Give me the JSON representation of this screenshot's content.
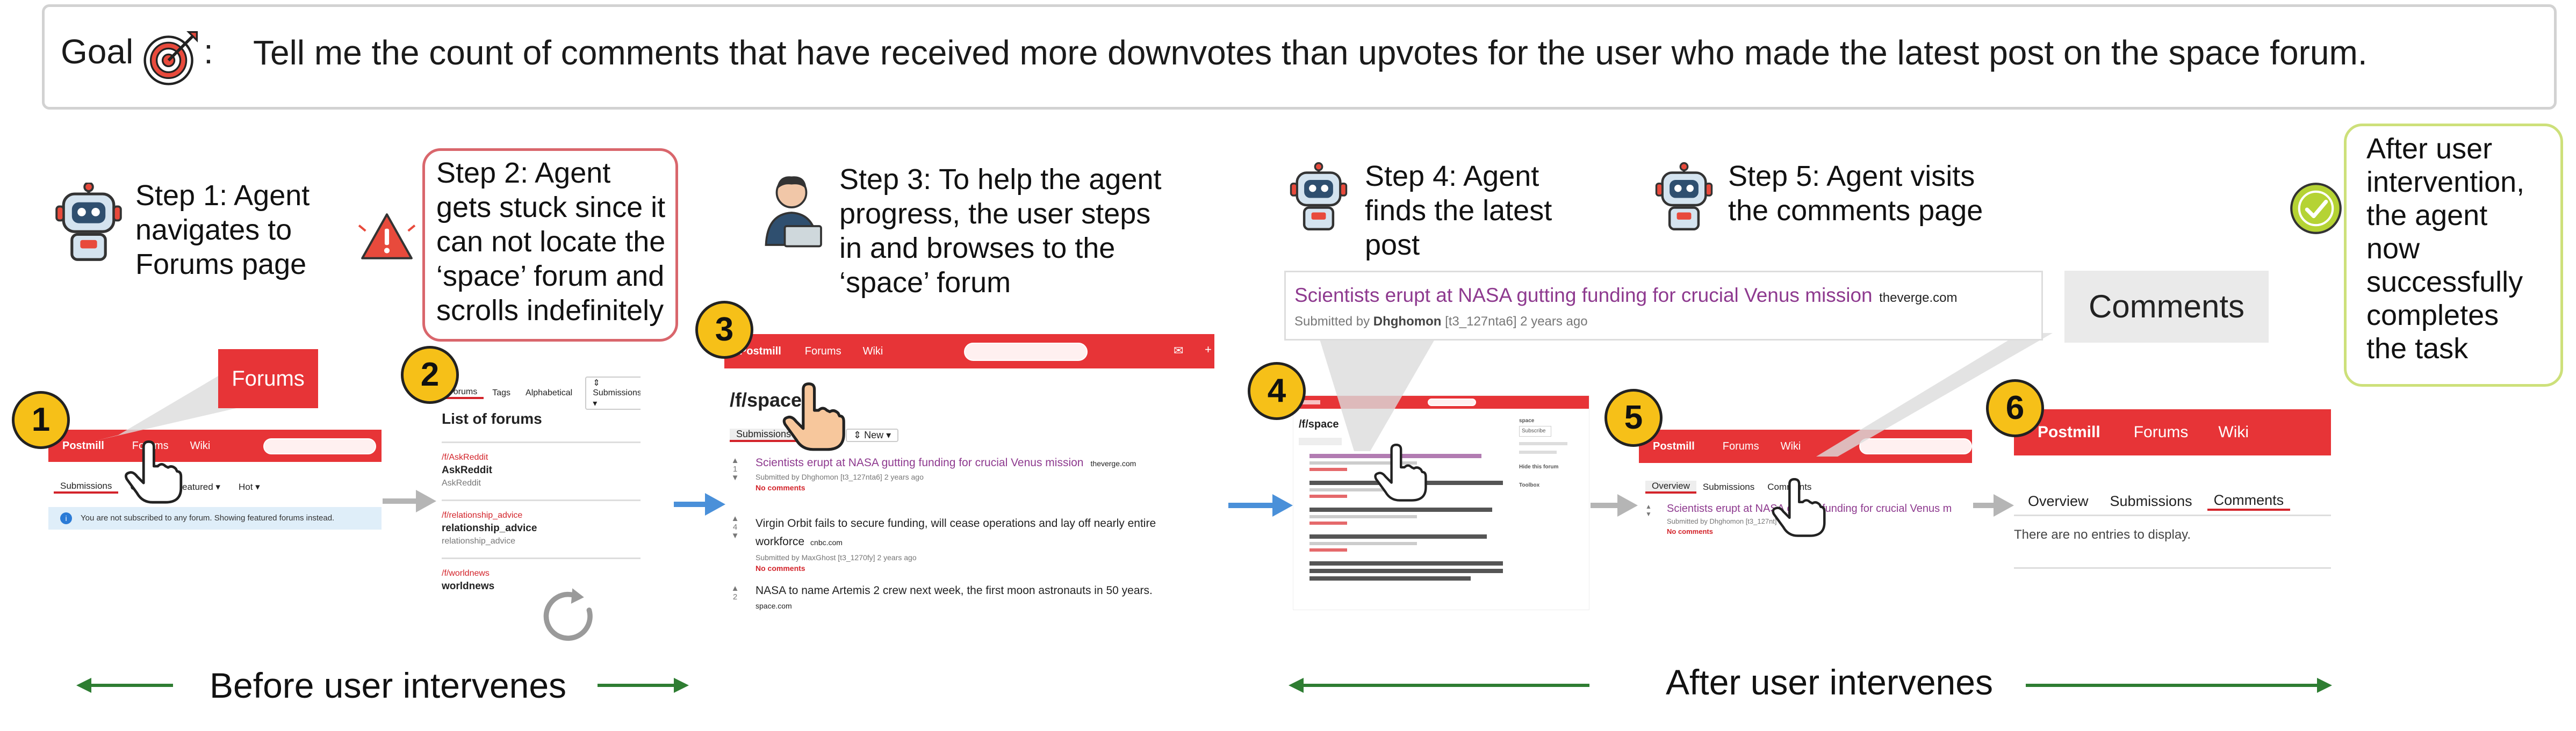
{
  "goal": {
    "label": "Goal",
    "colon": ":",
    "text": "Tell me the count of comments that have received more downvotes than upvotes for the user who made the latest post on the space forum."
  },
  "steps": [
    {
      "number": "1",
      "caption": [
        "Step 1: Agent",
        "navigates to",
        "Forums page"
      ]
    },
    {
      "number": "2",
      "caption": [
        "Step 2: Agent",
        "gets stuck since it",
        "can not locate the",
        "‘space’ forum and",
        "scrolls indefinitely"
      ]
    },
    {
      "number": "3",
      "caption": [
        "Step 3: To help the agent",
        "progress, the user steps",
        "in and browses to the",
        "‘space’ forum"
      ]
    },
    {
      "number": "4",
      "caption": [
        "Step 4: Agent",
        "finds the latest",
        "post"
      ]
    },
    {
      "number": "5",
      "caption": [
        "Step 5: Agent visits",
        "the comments page"
      ]
    },
    {
      "number": "6",
      "caption": [
        "After user",
        "intervention,",
        "the agent",
        "now",
        "successfully",
        "completes",
        "the task"
      ]
    }
  ],
  "bottom": {
    "before": "Before user intervenes",
    "after": "After user intervenes"
  },
  "panel1": {
    "callout": "Forums",
    "brand": "Postmill",
    "nav": [
      "Forums",
      "Wiki"
    ],
    "subtabs": [
      "Submissions",
      "C",
      "Featured ▾",
      "Hot ▾"
    ],
    "notice": "You are not subscribed to any forum. Showing featured forums instead."
  },
  "panel2": {
    "tabs": [
      "Forums",
      "Tags",
      "Alphabetical",
      "⇕ Submissions ▾"
    ],
    "heading": "List of forums",
    "forums": [
      {
        "slug": "/f/AskReddit",
        "name": "AskReddit",
        "desc": "AskReddit"
      },
      {
        "slug": "/f/relationship_advice",
        "name": "relationship_advice",
        "desc": "relationship_advice"
      },
      {
        "slug": "/f/worldnews",
        "name": "worldnews",
        "desc": ""
      }
    ]
  },
  "panel3": {
    "brand": "Postmill",
    "nav": [
      "Forums",
      "Wiki"
    ],
    "heading": "/f/space",
    "subtabs": [
      "Submissions",
      "⇕ New ▾"
    ],
    "posts": [
      {
        "title": "Scientists erupt at NASA gutting funding for crucial Venus mission",
        "source": "theverge.com",
        "meta": "Submitted by Dhghomon [t3_127nta6] 2 years ago",
        "comments": "No comments",
        "votes": "1"
      },
      {
        "title": "Virgin Orbit fails to secure funding, will cease operations and lay off nearly entire workforce",
        "source": "cnbc.com",
        "meta": "Submitted by MaxGhost [t3_1270fy] 2 years ago",
        "comments": "No comments",
        "votes": "4"
      },
      {
        "title": "NASA to name Artemis 2 crew next week, the first moon astronauts in 50 years.",
        "source": "space.com",
        "meta": "",
        "comments": "",
        "votes": "2"
      }
    ]
  },
  "panel4": {
    "callout_title": "Scientists erupt at NASA gutting funding for crucial Venus mission",
    "callout_source": "theverge.com",
    "callout_meta_prefix": "Submitted by",
    "callout_user": "Dhghomon",
    "callout_meta_suffix": "[t3_127nta6] 2 years ago",
    "heading": "/f/space",
    "sidebar": [
      "space",
      "Subscribe",
      "Hide this forum",
      "Toolbox"
    ]
  },
  "panel5": {
    "callout": "Comments",
    "brand": "Postmill",
    "nav": [
      "Forums",
      "Wiki"
    ],
    "subtabs": [
      "Overview",
      "Submissions",
      "Comments"
    ],
    "post_title": "Scientists erupt at NASA gutting funding for crucial Venus m",
    "post_meta": "Submitted by Dhghomon [t3_127nt] in space",
    "post_comments": "No comments"
  },
  "panel6": {
    "brand": "Postmill",
    "nav": [
      "Forums",
      "Wiki"
    ],
    "subtabs": [
      "Overview",
      "Submissions",
      "Comments"
    ],
    "empty": "There are no entries to display."
  },
  "colors": {
    "navbar": "#e73437",
    "badge": "#f6c018",
    "stuck_border": "#d9666c",
    "final_border": "#cde07a",
    "blue_arrow": "#4a90d9",
    "gray_arrow": "#b5b5b5",
    "green_arrow": "#2e7d32",
    "link_purple": "#8e3a8f"
  }
}
